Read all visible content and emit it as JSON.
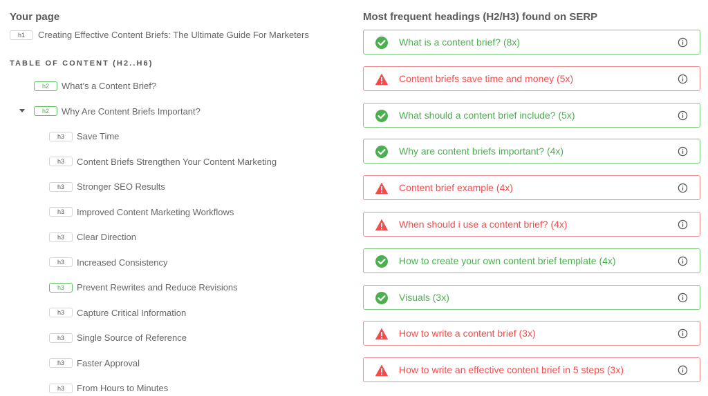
{
  "your_page": {
    "title": "Your page",
    "h1": {
      "tag": "h1",
      "text": "Creating Effective Content Briefs: The Ultimate Guide For Marketers"
    },
    "toc_title": "TABLE OF CONTENT (H2..H6)",
    "toc": [
      {
        "tag": "h2",
        "text": "What’s a Content Brief?",
        "matched": true,
        "collapsible": false
      },
      {
        "tag": "h2",
        "text": "Why Are Content Briefs Important?",
        "matched": true,
        "collapsible": true,
        "expanded": true
      },
      {
        "tag": "h3",
        "text": "Save Time",
        "matched": false
      },
      {
        "tag": "h3",
        "text": "Content Briefs Strengthen Your Content Marketing",
        "matched": false
      },
      {
        "tag": "h3",
        "text": "Stronger SEO Results",
        "matched": false
      },
      {
        "tag": "h3",
        "text": "Improved Content Marketing Workflows",
        "matched": false
      },
      {
        "tag": "h3",
        "text": "Clear Direction",
        "matched": false
      },
      {
        "tag": "h3",
        "text": "Increased Consistency",
        "matched": false
      },
      {
        "tag": "h3",
        "text": "Prevent Rewrites and Reduce Revisions",
        "matched": true
      },
      {
        "tag": "h3",
        "text": "Capture Critical Information",
        "matched": false
      },
      {
        "tag": "h3",
        "text": "Single Source of Reference",
        "matched": false
      },
      {
        "tag": "h3",
        "text": "Faster Approval",
        "matched": false
      },
      {
        "tag": "h3",
        "text": "From Hours to Minutes",
        "matched": false
      }
    ]
  },
  "serp": {
    "title": "Most frequent headings (H2/H3) found on SERP",
    "headings": [
      {
        "text": "What is a content brief? (8x)",
        "status": "found"
      },
      {
        "text": "Content briefs save time and money (5x)",
        "status": "missing"
      },
      {
        "text": "What should a content brief include? (5x)",
        "status": "found"
      },
      {
        "text": "Why are content briefs important? (4x)",
        "status": "found"
      },
      {
        "text": "Content brief example (4x)",
        "status": "missing"
      },
      {
        "text": "When should i use a content brief? (4x)",
        "status": "missing"
      },
      {
        "text": "How to create your own content brief template (4x)",
        "status": "found"
      },
      {
        "text": "Visuals (3x)",
        "status": "found"
      },
      {
        "text": "How to write a content brief (3x)",
        "status": "missing"
      },
      {
        "text": "How to write an effective content brief in 5 steps (3x)",
        "status": "missing"
      }
    ]
  },
  "colors": {
    "found": "#4caf50",
    "missing": "#f44c4c",
    "found_border": "#7ccb7f",
    "missing_border": "#f28b8b"
  },
  "icons": {
    "found": "check-circle-icon",
    "missing": "warning-triangle-icon",
    "info": "info-circle-icon",
    "expand": "caret-down-icon"
  }
}
